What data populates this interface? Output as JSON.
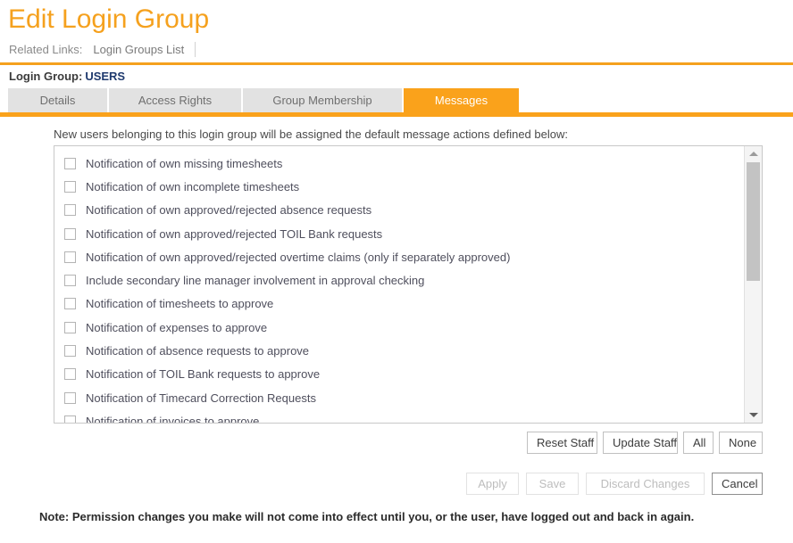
{
  "header": {
    "title": "Edit Login Group",
    "related_links_label": "Related Links:",
    "related_links": [
      {
        "label": "Login Groups List"
      }
    ],
    "group_label": "Login Group:",
    "group_value": "USERS"
  },
  "tabs": [
    {
      "label": "Details",
      "active": false
    },
    {
      "label": "Access Rights",
      "active": false
    },
    {
      "label": "Group Membership",
      "active": false
    },
    {
      "label": "Messages",
      "active": true
    }
  ],
  "main": {
    "instruction": "New users belonging to this login group will be assigned the default message actions defined below:",
    "items": [
      {
        "label": "Notification of own missing timesheets",
        "checked": false
      },
      {
        "label": "Notification of own incomplete timesheets",
        "checked": false
      },
      {
        "label": "Notification of own approved/rejected absence requests",
        "checked": false
      },
      {
        "label": "Notification of own approved/rejected TOIL Bank requests",
        "checked": false
      },
      {
        "label": "Notification of own approved/rejected overtime claims (only if separately approved)",
        "checked": false
      },
      {
        "label": "Include secondary line manager involvement in approval checking",
        "checked": false
      },
      {
        "label": "Notification of timesheets to approve",
        "checked": false
      },
      {
        "label": "Notification of expenses to approve",
        "checked": false
      },
      {
        "label": "Notification of absence requests to approve",
        "checked": false
      },
      {
        "label": "Notification of TOIL Bank requests to approve",
        "checked": false
      },
      {
        "label": "Notification of Timecard Correction Requests",
        "checked": false
      },
      {
        "label": "Notification of invoices to approve",
        "checked": false
      }
    ]
  },
  "staff_buttons": [
    {
      "label": "Reset Staff",
      "enabled": true
    },
    {
      "label": "Update Staff",
      "enabled": true
    },
    {
      "label": "All",
      "enabled": true
    },
    {
      "label": "None",
      "enabled": true
    }
  ],
  "action_buttons": [
    {
      "label": "Apply",
      "enabled": false
    },
    {
      "label": "Save",
      "enabled": false
    },
    {
      "label": "Discard Changes",
      "enabled": false
    },
    {
      "label": "Cancel",
      "enabled": true
    }
  ],
  "footer": {
    "note": "Note: Permission changes you make will not come into effect until you, or the user, have logged out and back in again."
  },
  "colors": {
    "accent_orange": "#FAA21B",
    "title_orange": "#F5A11E",
    "group_value_navy": "#1F3A6E",
    "tab_inactive_bg": "#E2E2E2",
    "list_border": "#C8C8C8"
  }
}
